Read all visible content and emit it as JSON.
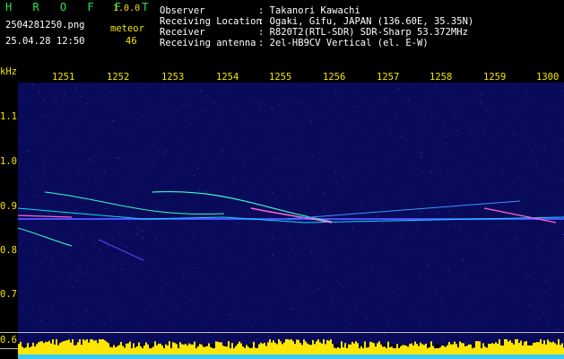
{
  "header": {
    "app_name": "H R O F F T",
    "version": "1.0.0",
    "filename": "2504281250.png",
    "datetime": "25.04.28 12:50",
    "meteor_label": "meteor",
    "meteor_count": "46",
    "info": [
      {
        "label": "Observer",
        "value": ": Takanori Kawachi"
      },
      {
        "label": "Receiving Location",
        "value": ": Ogaki, Gifu, JAPAN (136.60E, 35.35N)"
      },
      {
        "label": "Receiver",
        "value": ": R820T2(RTL-SDR) SDR-Sharp 53.372MHz"
      },
      {
        "label": "Receiving antenna",
        "value": ": 2el-HB9CV Vertical (el. E-W)"
      }
    ]
  },
  "axis": {
    "y_unit": "kHz",
    "x_ticks": [
      "1251",
      "1252",
      "1253",
      "1254",
      "1255",
      "1256",
      "1257",
      "1258",
      "1259",
      "1300"
    ],
    "y_ticks": [
      "1.1",
      "1.0",
      "0.9",
      "0.8",
      "0.7",
      "0.6"
    ]
  },
  "colors": {
    "text": "#ffffff",
    "accent_green": "#27e84a",
    "accent_yellow": "#f2e500",
    "background": "#000000",
    "spectrogram_bg": "#0a0a5a",
    "signal": "#ff66cc",
    "signal_alt": "#33ffcc",
    "level_bar": "#ffe600",
    "level_base": "#33ccff"
  }
}
